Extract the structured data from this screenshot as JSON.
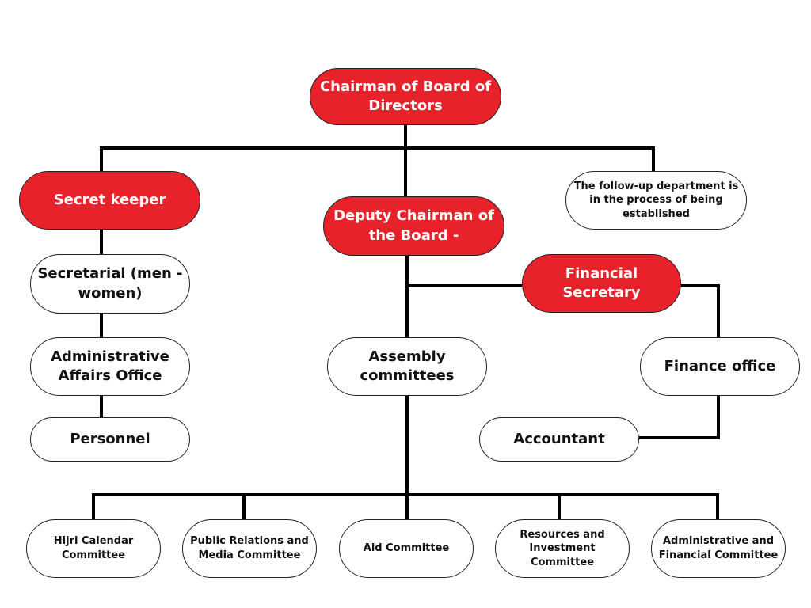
{
  "colors": {
    "accent": "#e8222b",
    "line": "#000000",
    "node_fill": "#ffffff"
  },
  "nodes": {
    "chairman": "Chairman of Board of Directors",
    "secret_keeper": "Secret keeper",
    "deputy": "Deputy Chairman of the Board -",
    "followup": "The follow-up department is in the process of being established",
    "financial_secretary": "Financial Secretary",
    "secretarial": "Secretarial (men - women)",
    "admin_affairs": "Administrative Affairs Office",
    "personnel": "Personnel",
    "assembly": "Assembly committees",
    "finance_office": "Finance office",
    "accountant": "Accountant"
  },
  "committees": [
    "Hijri Calendar Committee",
    "Public Relations and Media Committee",
    "Aid Committee",
    "Resources and Investment Committee",
    "Administrative and Financial Committee"
  ]
}
